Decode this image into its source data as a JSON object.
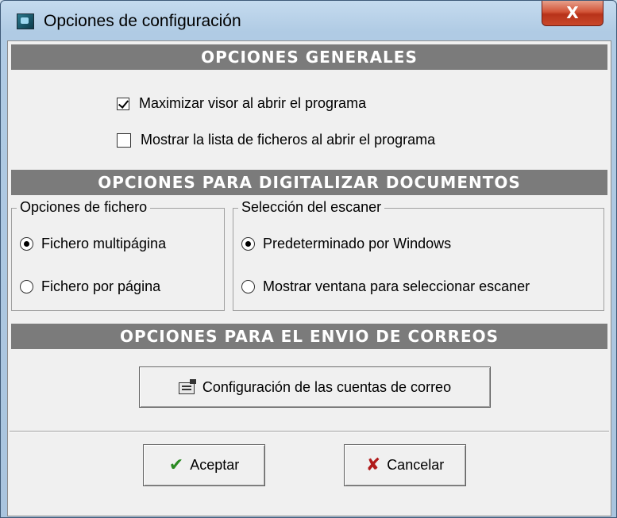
{
  "window": {
    "title": "Opciones de configuración",
    "close_label": "X"
  },
  "general": {
    "header": "OPCIONES GENERALES",
    "maximize_label": "Maximizar visor al abrir el programa",
    "maximize_checked": true,
    "show_files_label": "Mostrar la lista de ficheros al abrir el programa",
    "show_files_checked": false
  },
  "scan": {
    "header": "OPCIONES PARA DIGITALIZAR DOCUMENTOS",
    "file_group": {
      "legend": "Opciones de fichero",
      "options": [
        {
          "label": "Fichero multipágina",
          "selected": true
        },
        {
          "label": "Fichero por página",
          "selected": false
        }
      ]
    },
    "scanner_group": {
      "legend": "Selección del escaner",
      "options": [
        {
          "label": "Predeterminado por Windows",
          "selected": true
        },
        {
          "label": "Mostrar ventana para seleccionar escaner",
          "selected": false
        }
      ]
    }
  },
  "mail": {
    "header": "OPCIONES PARA EL ENVIO DE CORREOS",
    "accounts_button": "Configuración de las cuentas de correo"
  },
  "footer": {
    "accept_label": "Aceptar",
    "cancel_label": "Cancelar"
  },
  "icons": {
    "title": "app-icon",
    "accounts": "config-card-icon",
    "accept": "checkmark-icon",
    "cancel": "red-x-icon"
  },
  "colors": {
    "section_header_bg": "#7b7b7b",
    "close_button": "#c9482b",
    "accept_icon": "#2a8a22",
    "cancel_icon": "#b01a1a"
  }
}
